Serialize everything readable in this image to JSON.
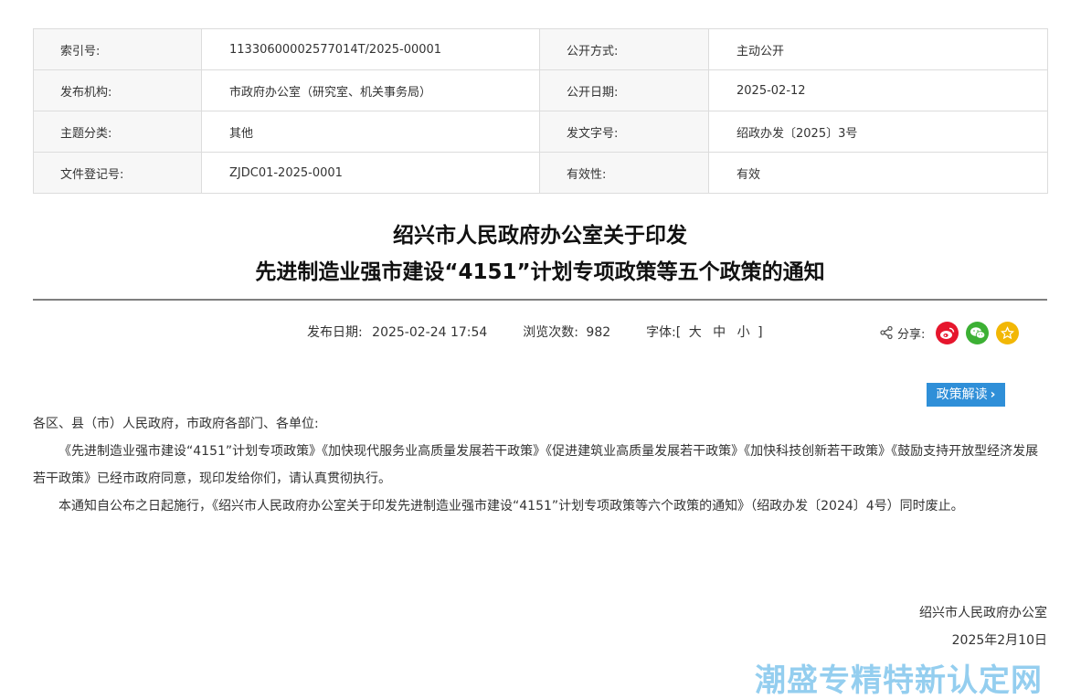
{
  "meta": {
    "rows": [
      {
        "label1": "索引号:",
        "value1": "11330600002577014T/2025-00001",
        "label2": "公开方式:",
        "value2": "主动公开"
      },
      {
        "label1": "发布机构:",
        "value1": "市政府办公室（研究室、机关事务局）",
        "label2": "公开日期:",
        "value2": "2025-02-12"
      },
      {
        "label1": "主题分类:",
        "value1": "其他",
        "label2": "发文字号:",
        "value2": "绍政办发〔2025〕3号"
      },
      {
        "label1": "文件登记号:",
        "value1": "ZJDC01-2025-0001",
        "label2": "有效性:",
        "value2": "有效"
      }
    ]
  },
  "title": {
    "line1": "绍兴市人民政府办公室关于印发",
    "line2": "先进制造业强市建设“4151”计划专项政策等五个政策的通知"
  },
  "info": {
    "publish_label": "发布日期:",
    "publish_value": "2025-02-24 17:54",
    "views_label": "浏览次数:",
    "views_value": "982",
    "font_label": "字体:[",
    "font_large": "大",
    "font_medium": "中",
    "font_small": "小",
    "font_end": "]"
  },
  "share": {
    "label": "分享:",
    "weibo_icon": "weibo-icon",
    "wechat_icon": "wechat-icon",
    "favorite_icon": "star-icon",
    "colors": {
      "weibo": "#e6162d",
      "wechat": "#3cb034",
      "favorite": "#f2b705"
    }
  },
  "policy_button": {
    "label": "政策解读",
    "accent": "#2f8fd8"
  },
  "body": {
    "greeting": "各区、县（市）人民政府，市政府各部门、各单位:",
    "para1": "《先进制造业强市建设“4151”计划专项政策》《加快现代服务业高质量发展若干政策》《促进建筑业高质量发展若干政策》《加快科技创新若干政策》《鼓励支持开放型经济发展若干政策》已经市政府同意，现印发给你们，请认真贯彻执行。",
    "para2": "本通知自公布之日起施行，《绍兴市人民政府办公室关于印发先进制造业强市建设“4151”计划专项政策等六个政策的通知》（绍政办发〔2024〕4号）同时废止。"
  },
  "signature": {
    "org": "绍兴市人民政府办公室",
    "date": "2025年2月10日"
  },
  "watermark": "潮盛专精特新认定网"
}
